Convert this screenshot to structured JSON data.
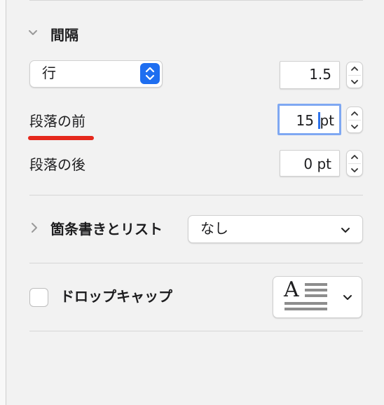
{
  "spacing": {
    "title": "間隔",
    "line_spacing_mode": "行",
    "line_spacing_value": "1.5",
    "before_label": "段落の前",
    "before_value_num": "15",
    "before_value_unit": "pt",
    "after_label": "段落の後",
    "after_value": "0 pt"
  },
  "bullets": {
    "title": "箇条書きとリスト",
    "selected": "なし"
  },
  "dropcap": {
    "label": "ドロップキャップ",
    "checked": false,
    "preview_letter": "A"
  },
  "colors": {
    "accent": "#1e6ef0",
    "annotation_underline": "#e5281c",
    "focus_ring": "#7fa8f2"
  }
}
